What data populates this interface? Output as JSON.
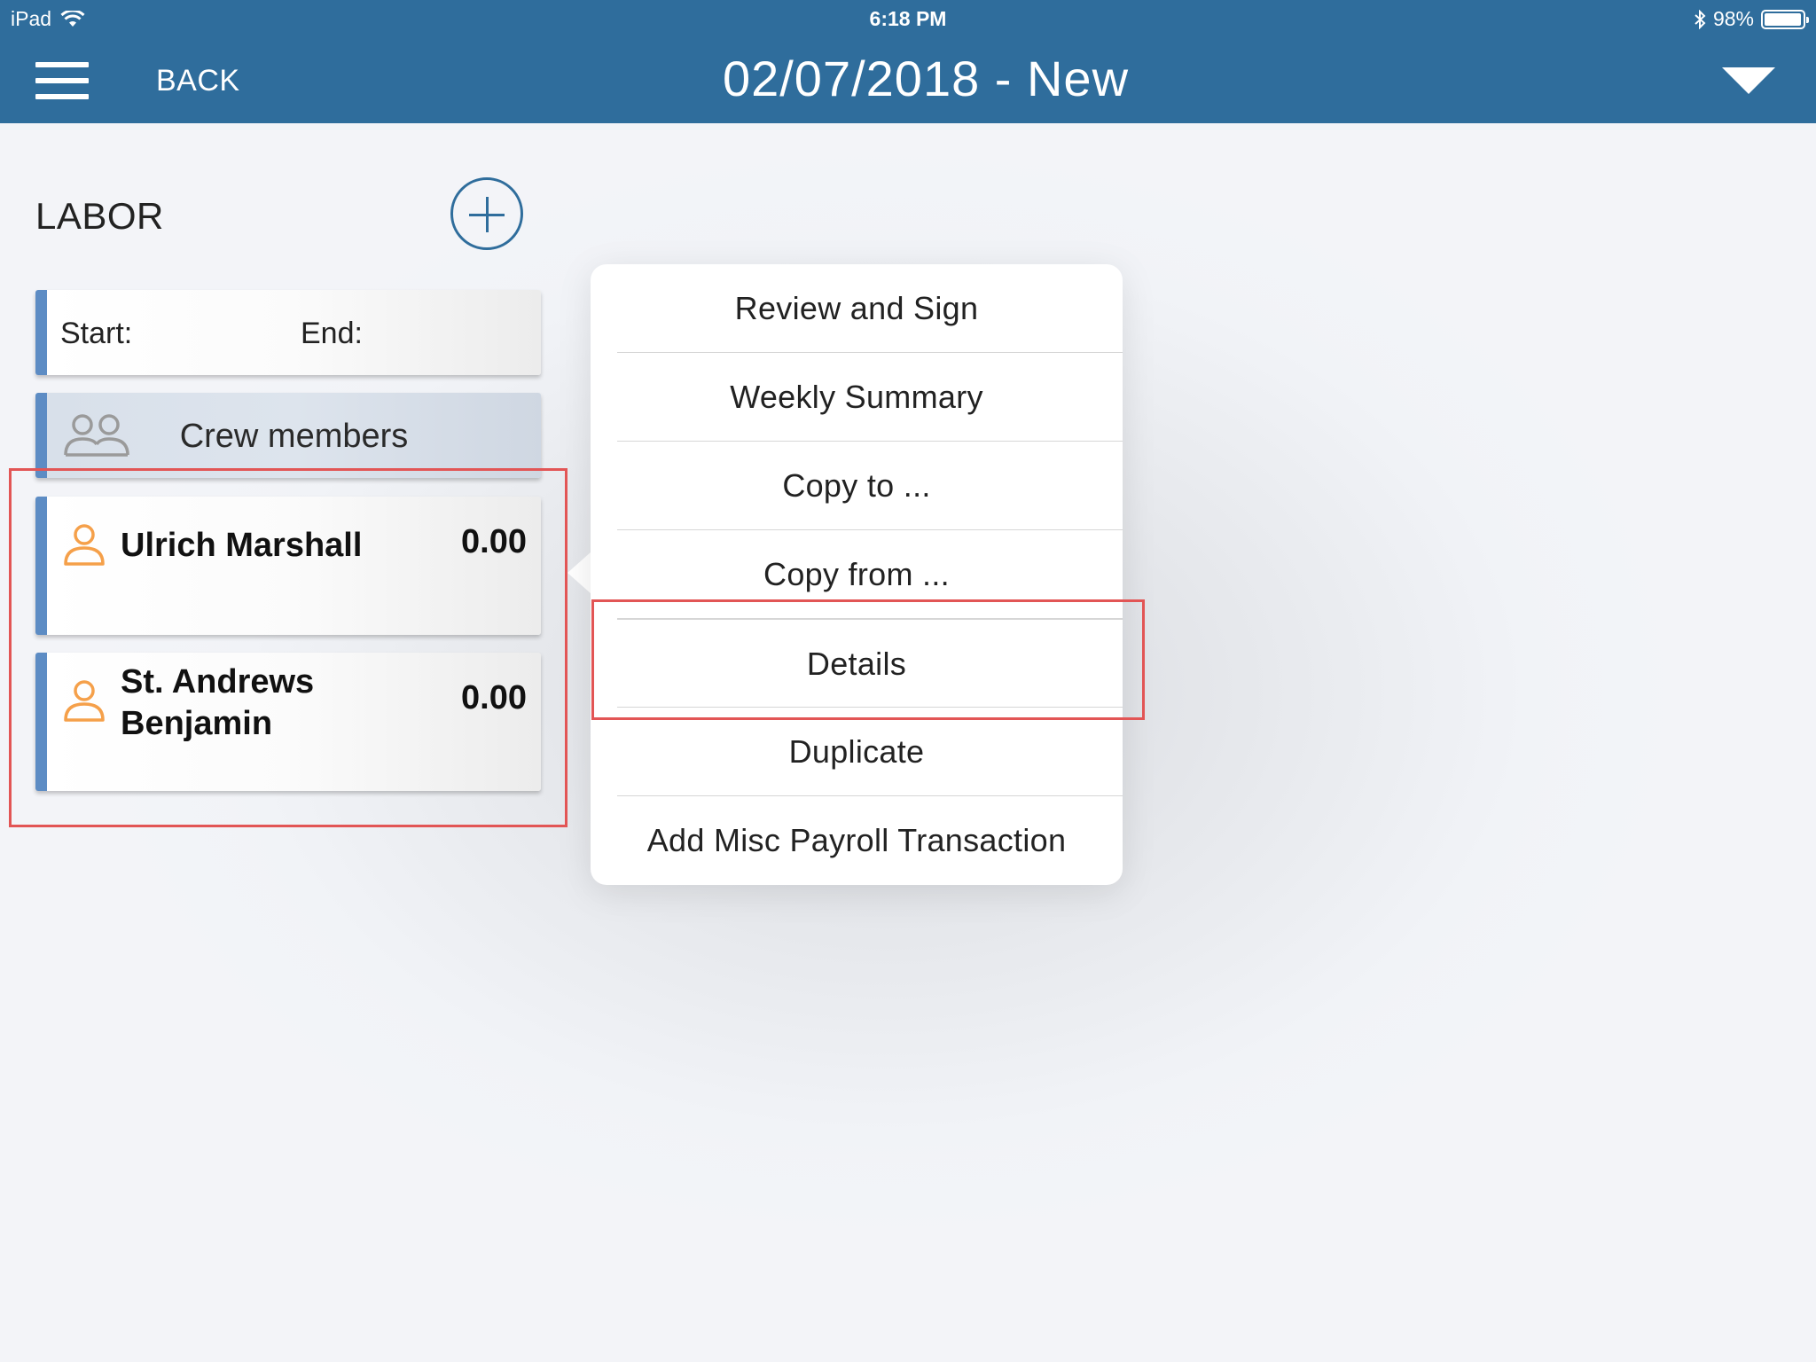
{
  "status_bar": {
    "device": "iPad",
    "time": "6:18 PM",
    "battery": "98%",
    "battery_level": 0.98
  },
  "header": {
    "back_label": "BACK",
    "title": "02/07/2018 - New"
  },
  "labor": {
    "title": "LABOR",
    "start_label": "Start:",
    "end_label": "End:",
    "crew_label": "Crew members",
    "members": [
      {
        "name": "Ulrich Marshall",
        "hours": "0.00"
      },
      {
        "name": "St. Andrews Benjamin",
        "hours": "0.00"
      }
    ]
  },
  "menu": {
    "items": [
      "Review and Sign",
      "Weekly Summary",
      "Copy to ...",
      "Copy from ...",
      "Details",
      "Duplicate",
      "Add Misc Payroll Transaction"
    ]
  },
  "colors": {
    "header_bg": "#2f6d9c",
    "card_accent": "#5d8cc4",
    "person_icon": "#f5a04a",
    "highlight": "#e25555"
  }
}
